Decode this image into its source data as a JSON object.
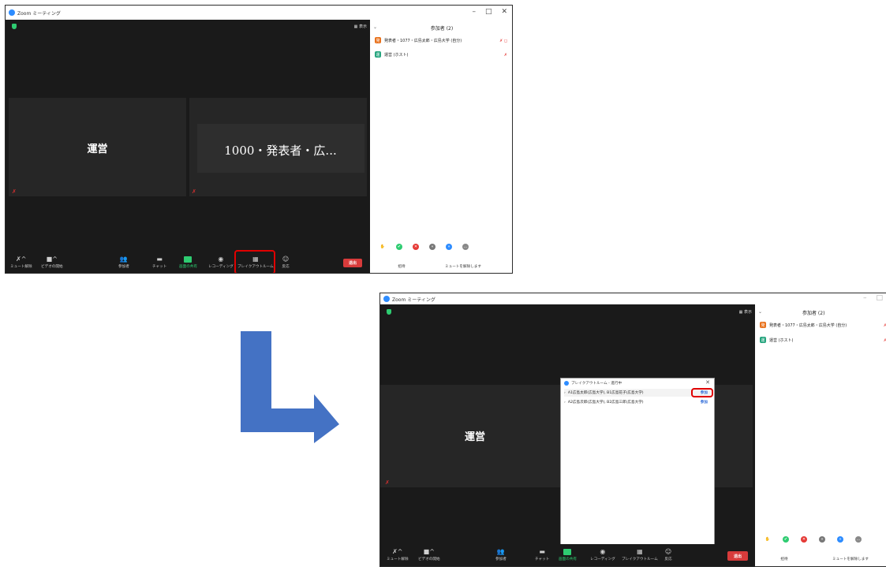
{
  "window_title": "Zoom ミーティング",
  "win_controls": {
    "minimize": "–",
    "maximize": "□",
    "close": "✕"
  },
  "view_label": "表示",
  "tiles": {
    "host_name": "運営",
    "presenter_name": "1000・発表者・広..."
  },
  "participants_panel": {
    "title": "参加者 (2)",
    "collapse_icon": "⌄",
    "participants": [
      {
        "avatar": "発",
        "name": "発表者・1077・広島太郎・広島大学 (自分)",
        "status": "✗ ◻",
        "avatar_color": "#e8701a"
      },
      {
        "avatar": "運",
        "name": "運営 (ホスト)",
        "status": "✗",
        "avatar_color": "#22a37c"
      }
    ],
    "reactions": [
      "✋",
      "✔",
      "✕",
      "«",
      "»",
      "…"
    ],
    "invite_label": "招待",
    "unmute_label": "ミュートを解除します"
  },
  "toolbar": {
    "unmute": "ミュート解除",
    "start_video": "ビデオの開始",
    "participants": "参加者",
    "participants_count": "2",
    "chat": "チャット",
    "share_screen": "画面の共有",
    "record": "レコーディング",
    "breakout": "ブレイクアウトルーム",
    "reactions": "反応",
    "leave": "退出"
  },
  "breakout_dialog": {
    "title": "ブレイクアウトルーム - 進行中",
    "close": "✕",
    "rooms": [
      {
        "name": "A1広島太郎(広島大学), B1広島花子(広島大学)",
        "join": "参加"
      },
      {
        "name": "A2広島次郎(広島大学), B2広島三郎(広島大学)",
        "join": "参加"
      }
    ]
  },
  "colors": {
    "accent_blue": "#2d8cff",
    "leave_red": "#d83b3b",
    "highlight_red": "#e00000",
    "arrow_blue": "#4472c4"
  }
}
